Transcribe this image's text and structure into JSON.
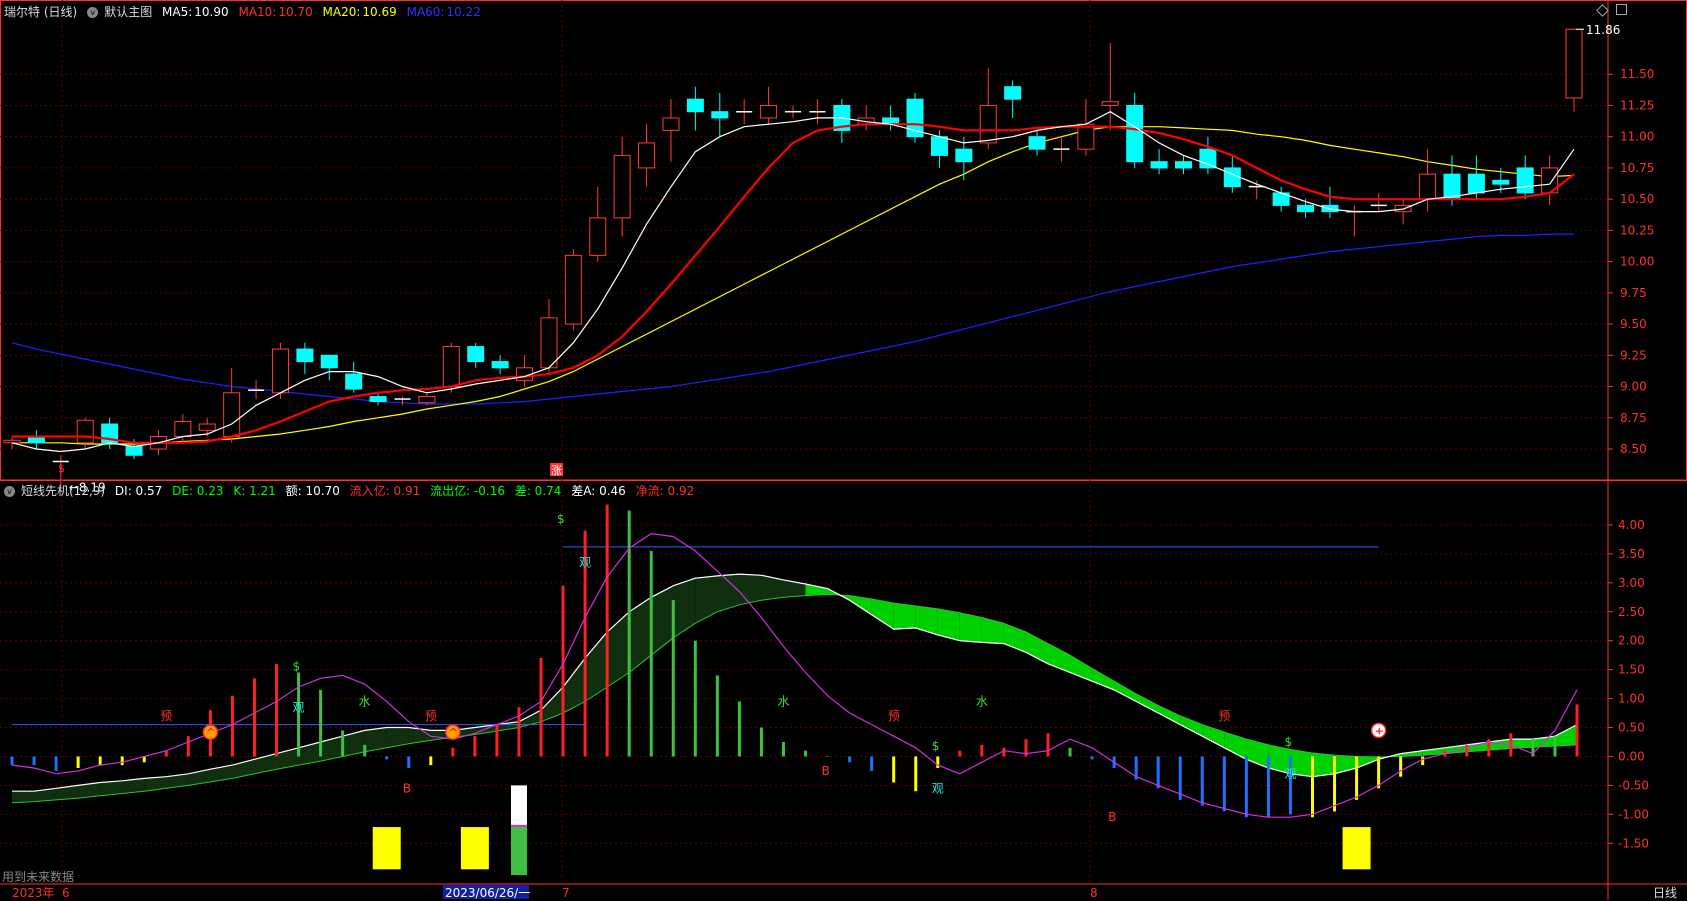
{
  "header": {
    "stock": "瑞尔特 (日线)",
    "main_chart": "默认主图",
    "ma5_label": "MA5:",
    "ma5": "10.90",
    "ma10_label": "MA10:",
    "ma10": "10.70",
    "ma20_label": "MA20:",
    "ma20": "10.69",
    "ma60_label": "MA60:",
    "ma60": "10.22"
  },
  "indicator_header": {
    "name": "短线先机(12,9)",
    "di": "DI: 0.57",
    "de": "DE: 0.23",
    "k": "K: 1.21",
    "amount": "额: 10.70",
    "inflow": "流入亿: 0.91",
    "outflow": "流出亿: -0.16",
    "diff": "差: 0.74",
    "diffA": "差A: 0.46",
    "net": "净流: 0.92"
  },
  "colors": {
    "up": "#ff3b3b",
    "down": "#00ffff",
    "ma5": "#ffffff",
    "ma10": "#ff0000",
    "ma20": "#ffff00",
    "ma60": "#2020ff",
    "grid": "#5a0000",
    "axis": "#ff3030"
  },
  "chart_data": [
    {
      "type": "candlestick",
      "yticks": [
        "11.50",
        "11.25",
        "11.00",
        "10.75",
        "10.50",
        "10.25",
        "10.00",
        "9.75",
        "9.50",
        "9.25",
        "9.00",
        "8.75",
        "8.50"
      ],
      "ylim": [
        8.3,
        11.95
      ],
      "annotations": {
        "high": "11.86",
        "low": "8.19",
        "bottom_marks": [
          "$",
          "涨"
        ]
      },
      "candles": [
        [
          8.55,
          8.57,
          8.6,
          8.5
        ],
        [
          8.6,
          8.55,
          8.65,
          8.5
        ],
        [
          8.4,
          8.4,
          8.45,
          8.2
        ],
        [
          8.55,
          8.73,
          8.75,
          8.5
        ],
        [
          8.7,
          8.55,
          8.75,
          8.5
        ],
        [
          8.52,
          8.45,
          8.58,
          8.42
        ],
        [
          8.5,
          8.6,
          8.65,
          8.45
        ],
        [
          8.6,
          8.72,
          8.78,
          8.55
        ],
        [
          8.65,
          8.7,
          8.75,
          8.6
        ],
        [
          8.6,
          8.95,
          9.15,
          8.55
        ],
        [
          8.97,
          8.97,
          9.05,
          8.9
        ],
        [
          8.95,
          9.3,
          9.35,
          8.9
        ],
        [
          9.3,
          9.2,
          9.35,
          9.1
        ],
        [
          9.25,
          9.15,
          9.25,
          9.05
        ],
        [
          9.1,
          8.98,
          9.2,
          8.95
        ],
        [
          8.92,
          8.88,
          8.95,
          8.85
        ],
        [
          8.9,
          8.9,
          8.92,
          8.85
        ],
        [
          8.87,
          8.92,
          8.95,
          8.85
        ],
        [
          9.0,
          9.32,
          9.35,
          8.95
        ],
        [
          9.32,
          9.2,
          9.35,
          9.15
        ],
        [
          9.2,
          9.15,
          9.25,
          9.1
        ],
        [
          9.05,
          9.15,
          9.25,
          9.0
        ],
        [
          9.15,
          9.55,
          9.7,
          9.1
        ],
        [
          9.5,
          10.05,
          10.1,
          9.45
        ],
        [
          10.05,
          10.35,
          10.6,
          10.0
        ],
        [
          10.35,
          10.85,
          11.0,
          10.2
        ],
        [
          10.75,
          10.95,
          11.1,
          10.6
        ],
        [
          11.05,
          11.15,
          11.3,
          10.8
        ],
        [
          11.3,
          11.2,
          11.4,
          11.05
        ],
        [
          11.2,
          11.15,
          11.35,
          11.0
        ],
        [
          11.2,
          11.2,
          11.3,
          11.1
        ],
        [
          11.15,
          11.25,
          11.4,
          11.1
        ],
        [
          11.2,
          11.2,
          11.25,
          11.15
        ],
        [
          11.2,
          11.2,
          11.3,
          11.1
        ],
        [
          11.25,
          11.05,
          11.3,
          10.95
        ],
        [
          11.1,
          11.15,
          11.25,
          11.05
        ],
        [
          11.15,
          11.1,
          11.25,
          11.05
        ],
        [
          11.3,
          11.0,
          11.35,
          10.95
        ],
        [
          11.0,
          10.85,
          11.05,
          10.75
        ],
        [
          10.9,
          10.8,
          11.0,
          10.65
        ],
        [
          10.95,
          11.25,
          11.55,
          10.9
        ],
        [
          11.4,
          11.3,
          11.45,
          11.15
        ],
        [
          11.0,
          10.9,
          11.05,
          10.85
        ],
        [
          10.9,
          10.9,
          11.0,
          10.8
        ],
        [
          10.9,
          11.1,
          11.3,
          10.85
        ],
        [
          11.25,
          11.28,
          11.75,
          11.05
        ],
        [
          11.25,
          10.8,
          11.35,
          10.75
        ],
        [
          10.8,
          10.75,
          10.9,
          10.7
        ],
        [
          10.8,
          10.75,
          10.85,
          10.7
        ],
        [
          10.9,
          10.75,
          11.0,
          10.7
        ],
        [
          10.75,
          10.6,
          10.85,
          10.55
        ],
        [
          10.6,
          10.6,
          10.65,
          10.5
        ],
        [
          10.55,
          10.45,
          10.6,
          10.4
        ],
        [
          10.45,
          10.4,
          10.5,
          10.35
        ],
        [
          10.45,
          10.4,
          10.6,
          10.35
        ],
        [
          10.4,
          10.4,
          10.45,
          10.2
        ],
        [
          10.45,
          10.45,
          10.55,
          10.4
        ],
        [
          10.4,
          10.45,
          10.5,
          10.3
        ],
        [
          10.5,
          10.7,
          10.9,
          10.4
        ],
        [
          10.7,
          10.5,
          10.85,
          10.45
        ],
        [
          10.7,
          10.55,
          10.85,
          10.5
        ],
        [
          10.65,
          10.62,
          10.75,
          10.55
        ],
        [
          10.75,
          10.55,
          10.85,
          10.5
        ],
        [
          10.55,
          10.75,
          10.85,
          10.45
        ],
        [
          11.31,
          11.86,
          11.87,
          11.2
        ]
      ],
      "ma5": [
        8.55,
        8.5,
        8.48,
        8.5,
        8.55,
        8.52,
        8.55,
        8.6,
        8.62,
        8.7,
        8.85,
        8.95,
        9.05,
        9.12,
        9.12,
        9.08,
        9.0,
        8.95,
        8.98,
        9.02,
        9.05,
        9.08,
        9.15,
        9.35,
        9.62,
        9.95,
        10.3,
        10.6,
        10.88,
        11.0,
        11.08,
        11.1,
        11.12,
        11.15,
        11.15,
        11.12,
        11.1,
        11.05,
        11.0,
        10.95,
        10.97,
        11.0,
        11.05,
        11.08,
        11.1,
        11.2,
        11.08,
        10.95,
        10.85,
        10.78,
        10.7,
        10.62,
        10.55,
        10.48,
        10.42,
        10.4,
        10.4,
        10.42,
        10.5,
        10.52,
        10.55,
        10.58,
        10.6,
        10.62,
        10.9
      ],
      "ma10": [
        8.6,
        8.6,
        8.6,
        8.6,
        8.58,
        8.55,
        8.55,
        8.55,
        8.56,
        8.6,
        8.65,
        8.72,
        8.8,
        8.88,
        8.92,
        8.95,
        8.97,
        8.98,
        9.0,
        9.05,
        9.07,
        9.08,
        9.1,
        9.15,
        9.25,
        9.4,
        9.6,
        9.82,
        10.05,
        10.28,
        10.52,
        10.75,
        10.95,
        11.05,
        11.08,
        11.1,
        11.1,
        11.1,
        11.08,
        11.05,
        11.05,
        11.05,
        11.07,
        11.08,
        11.08,
        11.08,
        11.06,
        11.03,
        10.98,
        10.92,
        10.85,
        10.75,
        10.65,
        10.58,
        10.52,
        10.5,
        10.5,
        10.5,
        10.5,
        10.5,
        10.5,
        10.5,
        10.52,
        10.55,
        10.7
      ],
      "ma20": [
        8.55,
        8.55,
        8.55,
        8.54,
        8.54,
        8.54,
        8.55,
        8.56,
        8.57,
        8.58,
        8.6,
        8.62,
        8.65,
        8.68,
        8.72,
        8.75,
        8.78,
        8.82,
        8.85,
        8.88,
        8.92,
        8.98,
        9.04,
        9.12,
        9.22,
        9.32,
        9.42,
        9.52,
        9.62,
        9.72,
        9.82,
        9.92,
        10.02,
        10.12,
        10.22,
        10.32,
        10.42,
        10.52,
        10.62,
        10.7,
        10.8,
        10.88,
        10.95,
        11.0,
        11.05,
        11.08,
        11.08,
        11.08,
        11.07,
        11.06,
        11.05,
        11.02,
        11.0,
        10.97,
        10.93,
        10.9,
        10.87,
        10.84,
        10.8,
        10.77,
        10.74,
        10.72,
        10.7,
        10.68,
        10.69
      ],
      "ma60": [
        9.35,
        9.3,
        9.26,
        9.22,
        9.18,
        9.14,
        9.1,
        9.06,
        9.03,
        9.0,
        8.98,
        8.96,
        8.94,
        8.92,
        8.9,
        8.88,
        8.87,
        8.86,
        8.86,
        8.86,
        8.87,
        8.88,
        8.9,
        8.92,
        8.94,
        8.96,
        8.98,
        9.0,
        9.03,
        9.06,
        9.09,
        9.12,
        9.16,
        9.2,
        9.24,
        9.28,
        9.32,
        9.36,
        9.41,
        9.46,
        9.51,
        9.56,
        9.61,
        9.66,
        9.71,
        9.76,
        9.8,
        9.84,
        9.88,
        9.92,
        9.96,
        9.99,
        10.02,
        10.05,
        10.08,
        10.1,
        10.12,
        10.14,
        10.16,
        10.18,
        10.2,
        10.21,
        10.21,
        10.22,
        10.22
      ]
    },
    {
      "type": "indicator",
      "yticks": [
        "4.00",
        "3.50",
        "3.00",
        "2.50",
        "2.00",
        "1.50",
        "1.00",
        "0.50",
        "0.00",
        "-0.50",
        "-1.00",
        "-1.50"
      ],
      "ylim": [
        -2.1,
        4.5
      ],
      "bars": [
        -0.15,
        -0.15,
        -0.25,
        -0.2,
        -0.15,
        -0.15,
        -0.1,
        0.1,
        0.35,
        0.8,
        1.05,
        1.35,
        1.6,
        1.45,
        1.15,
        0.45,
        0.2,
        -0.05,
        -0.2,
        -0.15,
        0.15,
        0.35,
        0.55,
        0.85,
        1.7,
        2.95,
        3.9,
        4.35,
        4.25,
        3.55,
        2.7,
        2.0,
        1.4,
        0.95,
        0.5,
        0.25,
        0.1,
        0.01,
        -0.1,
        -0.25,
        -0.45,
        -0.6,
        -0.2,
        0.1,
        0.2,
        0.15,
        0.3,
        0.4,
        0.15,
        -0.05,
        -0.2,
        -0.4,
        -0.55,
        -0.75,
        -0.85,
        -0.95,
        -1.05,
        -1.05,
        -1.0,
        -1.05,
        -0.95,
        -0.75,
        -0.55,
        -0.35,
        -0.15,
        0.1,
        0.2,
        0.3,
        0.4,
        0.3,
        0.35,
        0.9
      ],
      "bar_colors": [
        "b",
        "b",
        "b",
        "y",
        "y",
        "y",
        "y",
        "r",
        "r",
        "r",
        "r",
        "r",
        "r",
        "g",
        "g",
        "g",
        "g",
        "b",
        "b",
        "y",
        "r",
        "r",
        "r",
        "r",
        "r",
        "r",
        "r",
        "r",
        "g",
        "g",
        "g",
        "g",
        "g",
        "g",
        "g",
        "g",
        "g",
        "g",
        "b",
        "b",
        "y",
        "y",
        "y",
        "r",
        "r",
        "r",
        "r",
        "r",
        "g",
        "b",
        "b",
        "b",
        "b",
        "b",
        "b",
        "b",
        "b",
        "b",
        "b",
        "y",
        "y",
        "y",
        "y",
        "y",
        "y",
        "r",
        "r",
        "r",
        "r",
        "g",
        "g",
        "r"
      ],
      "purple": [
        -0.15,
        -0.2,
        -0.3,
        -0.25,
        -0.15,
        -0.1,
        0.0,
        0.1,
        0.25,
        0.4,
        0.55,
        0.75,
        0.95,
        1.2,
        1.35,
        1.4,
        1.25,
        0.95,
        0.6,
        0.35,
        0.3,
        0.4,
        0.55,
        0.7,
        0.95,
        1.6,
        2.4,
        3.1,
        3.6,
        3.85,
        3.8,
        3.55,
        3.2,
        2.85,
        2.4,
        1.9,
        1.45,
        1.05,
        0.75,
        0.55,
        0.35,
        0.15,
        -0.15,
        -0.3,
        -0.1,
        0.1,
        0.05,
        0.1,
        0.3,
        0.15,
        -0.1,
        -0.35,
        -0.5,
        -0.65,
        -0.8,
        -0.9,
        -1.0,
        -1.05,
        -1.05,
        -1.0,
        -0.85,
        -0.7,
        -0.5,
        -0.25,
        -0.05,
        0.05,
        0.15,
        0.25,
        0.2,
        0.05,
        0.45,
        1.15
      ],
      "white": [
        -0.6,
        -0.6,
        -0.55,
        -0.5,
        -0.45,
        -0.42,
        -0.38,
        -0.35,
        -0.3,
        -0.22,
        -0.15,
        -0.05,
        0.05,
        0.15,
        0.25,
        0.35,
        0.45,
        0.5,
        0.5,
        0.45,
        0.45,
        0.5,
        0.55,
        0.6,
        0.8,
        1.2,
        1.7,
        2.15,
        2.5,
        2.75,
        2.95,
        3.08,
        3.12,
        3.15,
        3.13,
        3.05,
        2.98,
        2.9,
        2.7,
        2.45,
        2.2,
        2.22,
        2.1,
        2.0,
        1.97,
        1.95,
        1.8,
        1.6,
        1.45,
        1.3,
        1.15,
        0.95,
        0.75,
        0.55,
        0.35,
        0.15,
        -0.05,
        -0.2,
        -0.3,
        -0.35,
        -0.3,
        -0.2,
        -0.05,
        0.05,
        0.1,
        0.15,
        0.2,
        0.25,
        0.3,
        0.3,
        0.35,
        0.55
      ],
      "green": [
        -0.8,
        -0.78,
        -0.75,
        -0.72,
        -0.68,
        -0.64,
        -0.6,
        -0.55,
        -0.5,
        -0.44,
        -0.38,
        -0.3,
        -0.22,
        -0.15,
        -0.08,
        0.0,
        0.08,
        0.15,
        0.22,
        0.28,
        0.33,
        0.38,
        0.44,
        0.5,
        0.6,
        0.75,
        0.95,
        1.2,
        1.45,
        1.75,
        2.05,
        2.3,
        2.5,
        2.62,
        2.7,
        2.75,
        2.78,
        2.8,
        2.78,
        2.72,
        2.65,
        2.6,
        2.55,
        2.48,
        2.4,
        2.3,
        2.15,
        1.95,
        1.75,
        1.52,
        1.3,
        1.08,
        0.88,
        0.7,
        0.55,
        0.42,
        0.3,
        0.2,
        0.12,
        0.06,
        0.02,
        0.0,
        -0.01,
        0.0,
        0.02,
        0.05,
        0.08,
        0.11,
        0.14,
        0.16,
        0.18,
        0.2
      ],
      "labels": [
        {
          "i": 13,
          "t": "$",
          "c": "g",
          "v": 1.55
        },
        {
          "i": 13,
          "t": "观",
          "c": "c",
          "v": 0.85
        },
        {
          "i": 16,
          "t": "水",
          "c": "g",
          "v": 0.95
        },
        {
          "i": 7,
          "t": "预",
          "c": "r",
          "v": 0.7
        },
        {
          "i": 19,
          "t": "预",
          "c": "r",
          "v": 0.7
        },
        {
          "i": 25,
          "t": "$",
          "c": "g",
          "v": 4.1
        },
        {
          "i": 26,
          "t": "观",
          "c": "c",
          "v": 3.35
        },
        {
          "i": 35,
          "t": "水",
          "c": "g",
          "v": 0.95
        },
        {
          "i": 40,
          "t": "预",
          "c": "r",
          "v": 0.7
        },
        {
          "i": 44,
          "t": "水",
          "c": "g",
          "v": 0.95
        },
        {
          "i": 42,
          "t": "$",
          "c": "g",
          "v": 0.18
        },
        {
          "i": 42,
          "t": "观",
          "c": "c",
          "v": -0.55
        },
        {
          "i": 55,
          "t": "预",
          "c": "r",
          "v": 0.7
        },
        {
          "i": 58,
          "t": "$",
          "c": "g",
          "v": 0.25
        },
        {
          "i": 58,
          "t": "观",
          "c": "c",
          "v": -0.3
        },
        {
          "i": 37,
          "t": "B",
          "c": "r",
          "v": -0.25
        },
        {
          "i": 18,
          "t": "B",
          "c": "r",
          "v": -0.55
        },
        {
          "i": 50,
          "t": "B",
          "c": "r",
          "v": -1.05
        }
      ],
      "hlines": [
        {
          "v": 0.55,
          "x0": 0,
          "x1": 26
        },
        {
          "v": 3.62,
          "x0": 25,
          "x1": 62
        }
      ],
      "yellow_blocks": [
        17,
        21,
        61
      ],
      "circles": [
        9,
        20,
        62
      ]
    }
  ],
  "xaxis": {
    "year": "2023年",
    "m6": "6",
    "cursor": "2023/06/26/一",
    "m7": "7",
    "m8": "8"
  },
  "footer": {
    "future_note": "用到未来数据",
    "period": "日线"
  }
}
